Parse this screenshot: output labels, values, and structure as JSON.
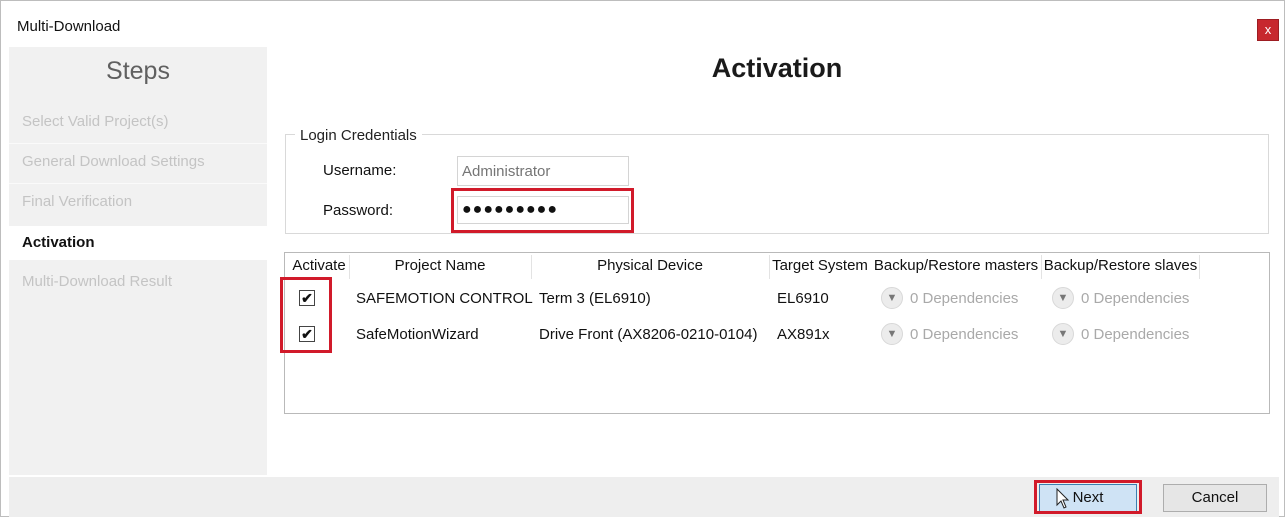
{
  "window": {
    "title": "Multi-Download",
    "close_label": "x"
  },
  "sidebar": {
    "heading": "Steps",
    "steps": [
      {
        "label": "Select Valid Project(s)"
      },
      {
        "label": "General Download Settings"
      },
      {
        "label": "Final Verification"
      },
      {
        "label": "Activation"
      },
      {
        "label": "Multi-Download Result"
      }
    ]
  },
  "main": {
    "title": "Activation",
    "login": {
      "group_label": "Login Credentials",
      "username_label": "Username:",
      "username_placeholder": "Administrator",
      "password_label": "Password:",
      "password_value": "●●●●●●●●●"
    },
    "grid": {
      "columns": [
        "Activate",
        "Project Name",
        "Physical Device",
        "Target System",
        "Backup/Restore masters",
        "Backup/Restore slaves"
      ],
      "rows": [
        {
          "activate": "✔",
          "project": "SAFEMOTION CONTROL",
          "device": "Term 3 (EL6910)",
          "target": "EL6910",
          "masters": "0 Dependencies",
          "slaves": "0 Dependencies"
        },
        {
          "activate": "✔",
          "project": "SafeMotionWizard",
          "device": "Drive Front (AX8206-0210-0104)",
          "target": "AX891x",
          "masters": "0 Dependencies",
          "slaves": "0 Dependencies"
        }
      ]
    }
  },
  "footer": {
    "next_label": "Next",
    "cancel_label": "Cancel"
  },
  "colors": {
    "highlight": "#d11a2a",
    "close": "#c7282e"
  },
  "icons": {
    "chevron": "chevron-down-icon",
    "cursor": "mouse-pointer-icon"
  }
}
